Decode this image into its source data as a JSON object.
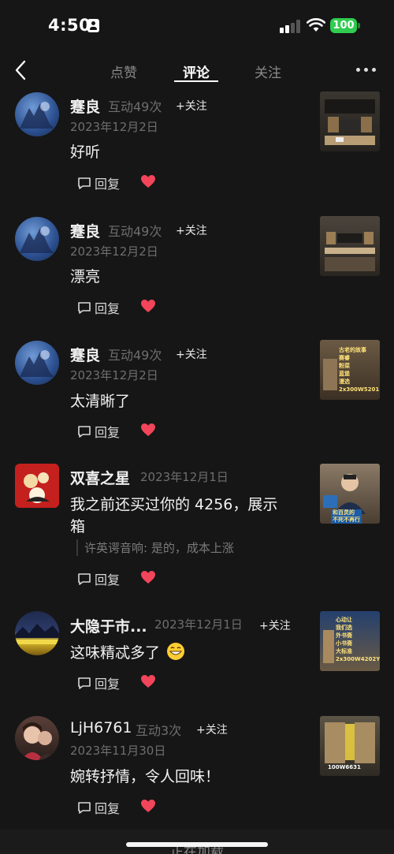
{
  "status": {
    "time": "4:50",
    "battery": "100"
  },
  "tabs": [
    "点赞",
    "评论",
    "关注"
  ],
  "comments": [
    {
      "name": "蹇良",
      "interact": "互动49次",
      "follow": "+关注",
      "date": "2023年12月2日",
      "text": "好听",
      "reply": "回复"
    },
    {
      "name": "蹇良",
      "interact": "互动49次",
      "follow": "+关注",
      "date": "2023年12月2日",
      "text": "漂亮",
      "reply": "回复"
    },
    {
      "name": "蹇良",
      "interact": "互动49次",
      "follow": "+关注",
      "date": "2023年12月2日",
      "text": "太清晰了",
      "reply": "回复",
      "thumb_lines": [
        "古老的故事",
        "赛睿",
        "粉菜",
        "蓝堡",
        "漫选",
        "2x300W5201"
      ]
    },
    {
      "name": "双喜之星",
      "date": "2023年12月1日",
      "text_line1": "我之前还买过你的 4256，展示",
      "text_line2": "箱",
      "quote": "许英谔音响: 是的，成本上涨",
      "reply": "回复",
      "thumb_lines": [
        "和百灵的",
        "不死不再行"
      ]
    },
    {
      "name": "大隐于市...",
      "date": "2023年12月1日",
      "follow": "+关注",
      "text": "这味精忒多了",
      "reply": "回复",
      "thumb_lines": [
        "心动让",
        "我们选",
        "外书斋",
        "小书斋",
        "大标准",
        "2x300W4202Y"
      ]
    },
    {
      "name": "LjH6761",
      "interact": "互动3次",
      "follow": "+关注",
      "date": "2023年11月30日",
      "text": "婉转抒情，令人回味！",
      "reply": "回复",
      "thumb_lines": [
        "100W6631"
      ]
    }
  ],
  "footer": {
    "loading": "正在加载"
  },
  "icons": {
    "back": "chevron-left-icon",
    "more": "more-dots-icon",
    "reply": "comment-bubble-icon",
    "like": "heart-icon"
  },
  "colors": {
    "background": "#161616",
    "like": "#f2455a",
    "battery": "#2fcc4f"
  }
}
